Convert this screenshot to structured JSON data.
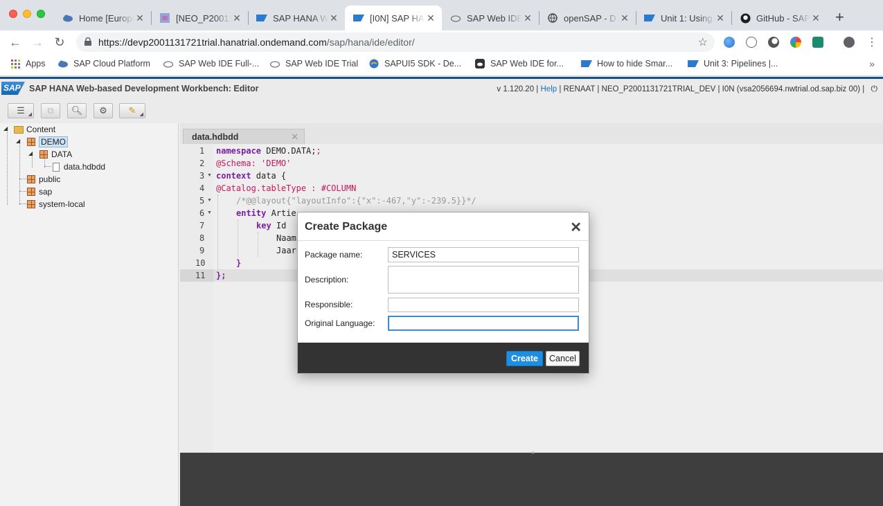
{
  "browser": {
    "tabs": [
      {
        "label": "Home [Europe",
        "icon": "cloud-icon"
      },
      {
        "label": "[NEO_P20011",
        "icon": "image-icon"
      },
      {
        "label": "SAP HANA W",
        "icon": "sap-icon"
      },
      {
        "label": "[I0N] SAP HA",
        "icon": "sap-icon"
      },
      {
        "label": "SAP Web IDE",
        "icon": "cloud-outline-icon"
      },
      {
        "label": "openSAP - D",
        "icon": "globe-icon"
      },
      {
        "label": "Unit 1: Using",
        "icon": "sap-icon"
      },
      {
        "label": "GitHub - SAP",
        "icon": "github-icon"
      }
    ],
    "url_host": "https://devp2001131721trial.hanatrial.ondemand.com",
    "url_path": "/sap/hana/ide/editor/",
    "bookmarks": [
      {
        "label": "Apps",
        "icon": "apps-grid-icon"
      },
      {
        "label": "SAP Cloud Platform",
        "icon": "cloud-icon"
      },
      {
        "label": "SAP Web IDE Full-...",
        "icon": "cloud-outline-icon"
      },
      {
        "label": "SAP Web IDE Trial",
        "icon": "cloud-outline-icon"
      },
      {
        "label": "SAPUI5 SDK - De...",
        "icon": "globe-icon"
      },
      {
        "label": "SAP Web IDE for...",
        "icon": "ide-icon"
      },
      {
        "label": "How to hide Smar...",
        "icon": "sap-icon"
      },
      {
        "label": "Unit 3: Pipelines |...",
        "icon": "sap-icon"
      }
    ]
  },
  "sap": {
    "logo": "SAP",
    "title": "SAP HANA Web-based Development Workbench: Editor",
    "version": "v 1.120.20",
    "help": "Help",
    "user": "RENAAT",
    "schema": "NEO_P2001131721TRIAL_DEV",
    "system": "I0N (vsa2056694.nwtrial.od.sap.biz 00)"
  },
  "tree": {
    "root": "Content",
    "demo": "DEMO",
    "data": "DATA",
    "file": "data.hdbdd",
    "public": "public",
    "sap": "sap",
    "system_local": "system-local"
  },
  "editor": {
    "tab_label": "data.hdbdd",
    "line_numbers": [
      "1",
      "2",
      "3",
      "4",
      "5",
      "6",
      "7",
      "8",
      "9",
      "10",
      "11"
    ],
    "lines": {
      "l1_kw": "namespace",
      "l1_rest": " DEMO.DATA;",
      "l2_anno": "@Schema:",
      "l2_str": " 'DEMO'",
      "l3_kw": "context",
      "l3_rest": " data {",
      "l4_anno": "@Catalog.tableType : #COLUMN",
      "l5_cmt": "/*@@layout{\"layoutInfo\":{\"x\":-467,\"y\":-239.5}}*/",
      "l6_kw": "entity",
      "l6_rest": " Artie",
      "l7_kw": "key",
      "l7_rest": " Id",
      "l8": "Naam",
      "l9": "Jaar",
      "l10": "}",
      "l11": "};"
    }
  },
  "dialog": {
    "title": "Create Package",
    "package_name_label": "Package name:",
    "package_name_value": "SERVICES",
    "description_label": "Description:",
    "description_value": "",
    "responsible_label": "Responsible:",
    "responsible_value": "",
    "language_label": "Original Language:",
    "language_value": "",
    "create": "Create",
    "cancel": "Cancel"
  },
  "colors": {
    "sap_blue": "#1f8ee0",
    "header_accent": "#1c4e80",
    "console_bg": "#3e3e3e"
  }
}
